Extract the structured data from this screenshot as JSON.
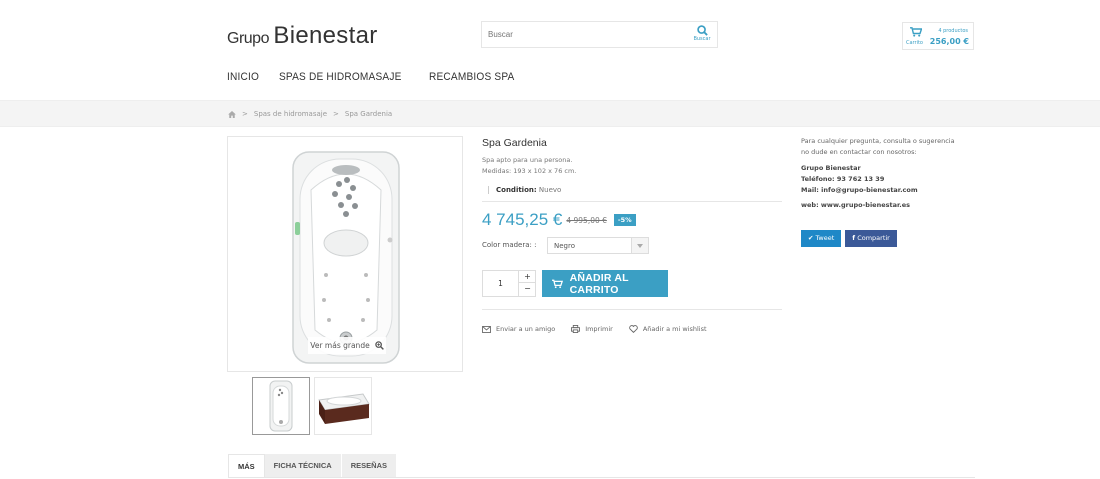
{
  "header": {
    "logo_small": "Grupo",
    "logo_big": "Bienestar",
    "search_placeholder": "Buscar",
    "search_button_label": "Buscar",
    "cart_label": "Carrito",
    "cart_count": "4 productos",
    "cart_total": "256,00 €"
  },
  "nav": {
    "items": [
      "INICIO",
      "SPAS DE HIDROMASAJE",
      "RECAMBIOS SPA"
    ]
  },
  "breadcrumb": {
    "sep": ">",
    "items": [
      "Spas de hidromasaje",
      "Spa Gardenia"
    ]
  },
  "gallery": {
    "zoom_label": "Ver más grande"
  },
  "product": {
    "name": "Spa Gardenia",
    "desc_line1": "Spa apto para una persona.",
    "desc_line2": "Medidas: 193 x 102 x 76 cm.",
    "condition_label": "Condition:",
    "condition_value": "Nuevo",
    "price": "4 745,25 €",
    "old_price": "4 995,00 €",
    "discount": "-5%",
    "color_label": "Color madera: :",
    "color_value": "Negro",
    "quantity": "1",
    "qty_plus": "+",
    "qty_minus": "−",
    "add_to_cart": "AÑADIR AL CARRITO",
    "action_send": "Enviar a un amigo",
    "action_print": "Imprimir",
    "action_wishlist": "Añadir a mi wishlist"
  },
  "contact": {
    "line1": "Para cualquier pregunta, consulta o sugerencia",
    "line2": "no dude en contactar con nosotros:",
    "company": "Grupo Bienestar",
    "phone": "Teléfono: 93 762 13 39",
    "mail": "Mail: info@grupo-bienestar.com",
    "web": "web: www.grupo-bienestar.es"
  },
  "social": {
    "tweet": "Tweet",
    "share": "Compartir"
  },
  "tabs": [
    "MÁS",
    "FICHA TÉCNICA",
    "RESEÑAS"
  ],
  "colors": {
    "accent": "#3b9fc4",
    "twitter": "#1e88c7",
    "facebook": "#3b5998"
  }
}
